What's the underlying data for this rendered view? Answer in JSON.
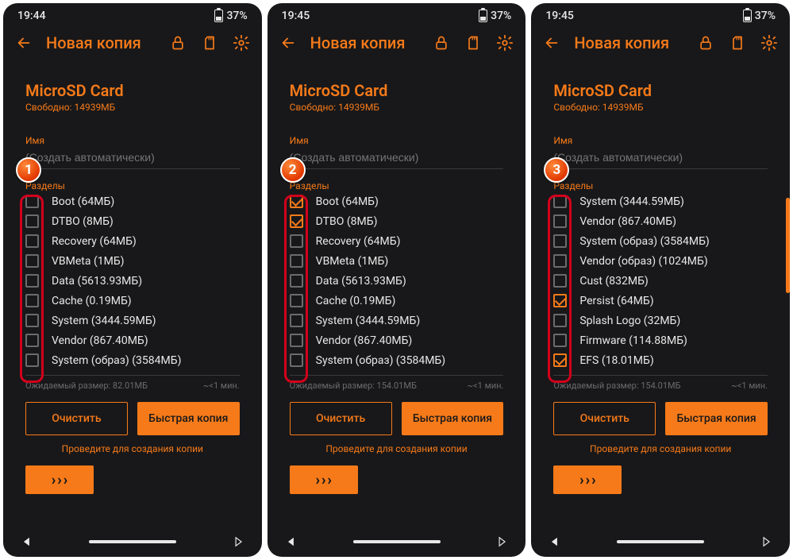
{
  "statusbar": {
    "time": "19:44",
    "time2": "19:45",
    "time3": "19:45",
    "battery": "37%"
  },
  "appbar": {
    "title": "Новая копия"
  },
  "storage": {
    "name": "MicroSD Card",
    "free": "Свободно: 14939МБ"
  },
  "field": {
    "name_label": "Имя",
    "name_placeholder": "(Создать автоматически)"
  },
  "sections_label": "Разделы",
  "est_size_label": "Ожидаемый размер:",
  "est_time": "~<1 мин.",
  "buttons": {
    "clear": "Очистить",
    "quick": "Быстрая копия"
  },
  "swipe_hint": "Проведите для создания копии",
  "screens": [
    {
      "badge": "1",
      "time": "19:44",
      "est_size": "82.01МБ",
      "partitions": [
        {
          "label": "Boot (64МБ)",
          "checked": false
        },
        {
          "label": "DTBO (8МБ)",
          "checked": false
        },
        {
          "label": "Recovery (64МБ)",
          "checked": false
        },
        {
          "label": "VBMeta (1МБ)",
          "checked": false
        },
        {
          "label": "Data (5613.93МБ)",
          "checked": false
        },
        {
          "label": "Cache (0.19МБ)",
          "checked": false
        },
        {
          "label": "System (3444.59МБ)",
          "checked": false
        },
        {
          "label": "Vendor (867.40МБ)",
          "checked": false
        },
        {
          "label": "System (образ) (3584МБ)",
          "checked": false
        }
      ]
    },
    {
      "badge": "2",
      "time": "19:45",
      "est_size": "154.01МБ",
      "partitions": [
        {
          "label": "Boot (64МБ)",
          "checked": true
        },
        {
          "label": "DTBO (8МБ)",
          "checked": true
        },
        {
          "label": "Recovery (64МБ)",
          "checked": false
        },
        {
          "label": "VBMeta (1МБ)",
          "checked": false
        },
        {
          "label": "Data (5613.93МБ)",
          "checked": false
        },
        {
          "label": "Cache (0.19МБ)",
          "checked": false
        },
        {
          "label": "System (3444.59МБ)",
          "checked": false
        },
        {
          "label": "Vendor (867.40МБ)",
          "checked": false
        },
        {
          "label": "System (образ) (3584МБ)",
          "checked": false
        }
      ]
    },
    {
      "badge": "3",
      "time": "19:45",
      "est_size": "154.01МБ",
      "scroll": true,
      "partitions": [
        {
          "label": "System (3444.59МБ)",
          "checked": false
        },
        {
          "label": "Vendor (867.40МБ)",
          "checked": false
        },
        {
          "label": "System (образ) (3584МБ)",
          "checked": false
        },
        {
          "label": "Vendor (образ) (1024МБ)",
          "checked": false
        },
        {
          "label": "Cust (832МБ)",
          "checked": false
        },
        {
          "label": "Persist (64МБ)",
          "checked": true
        },
        {
          "label": "Splash Logo (32МБ)",
          "checked": false
        },
        {
          "label": "Firmware (114.88МБ)",
          "checked": false
        },
        {
          "label": "EFS (18.01МБ)",
          "checked": true
        }
      ]
    }
  ]
}
